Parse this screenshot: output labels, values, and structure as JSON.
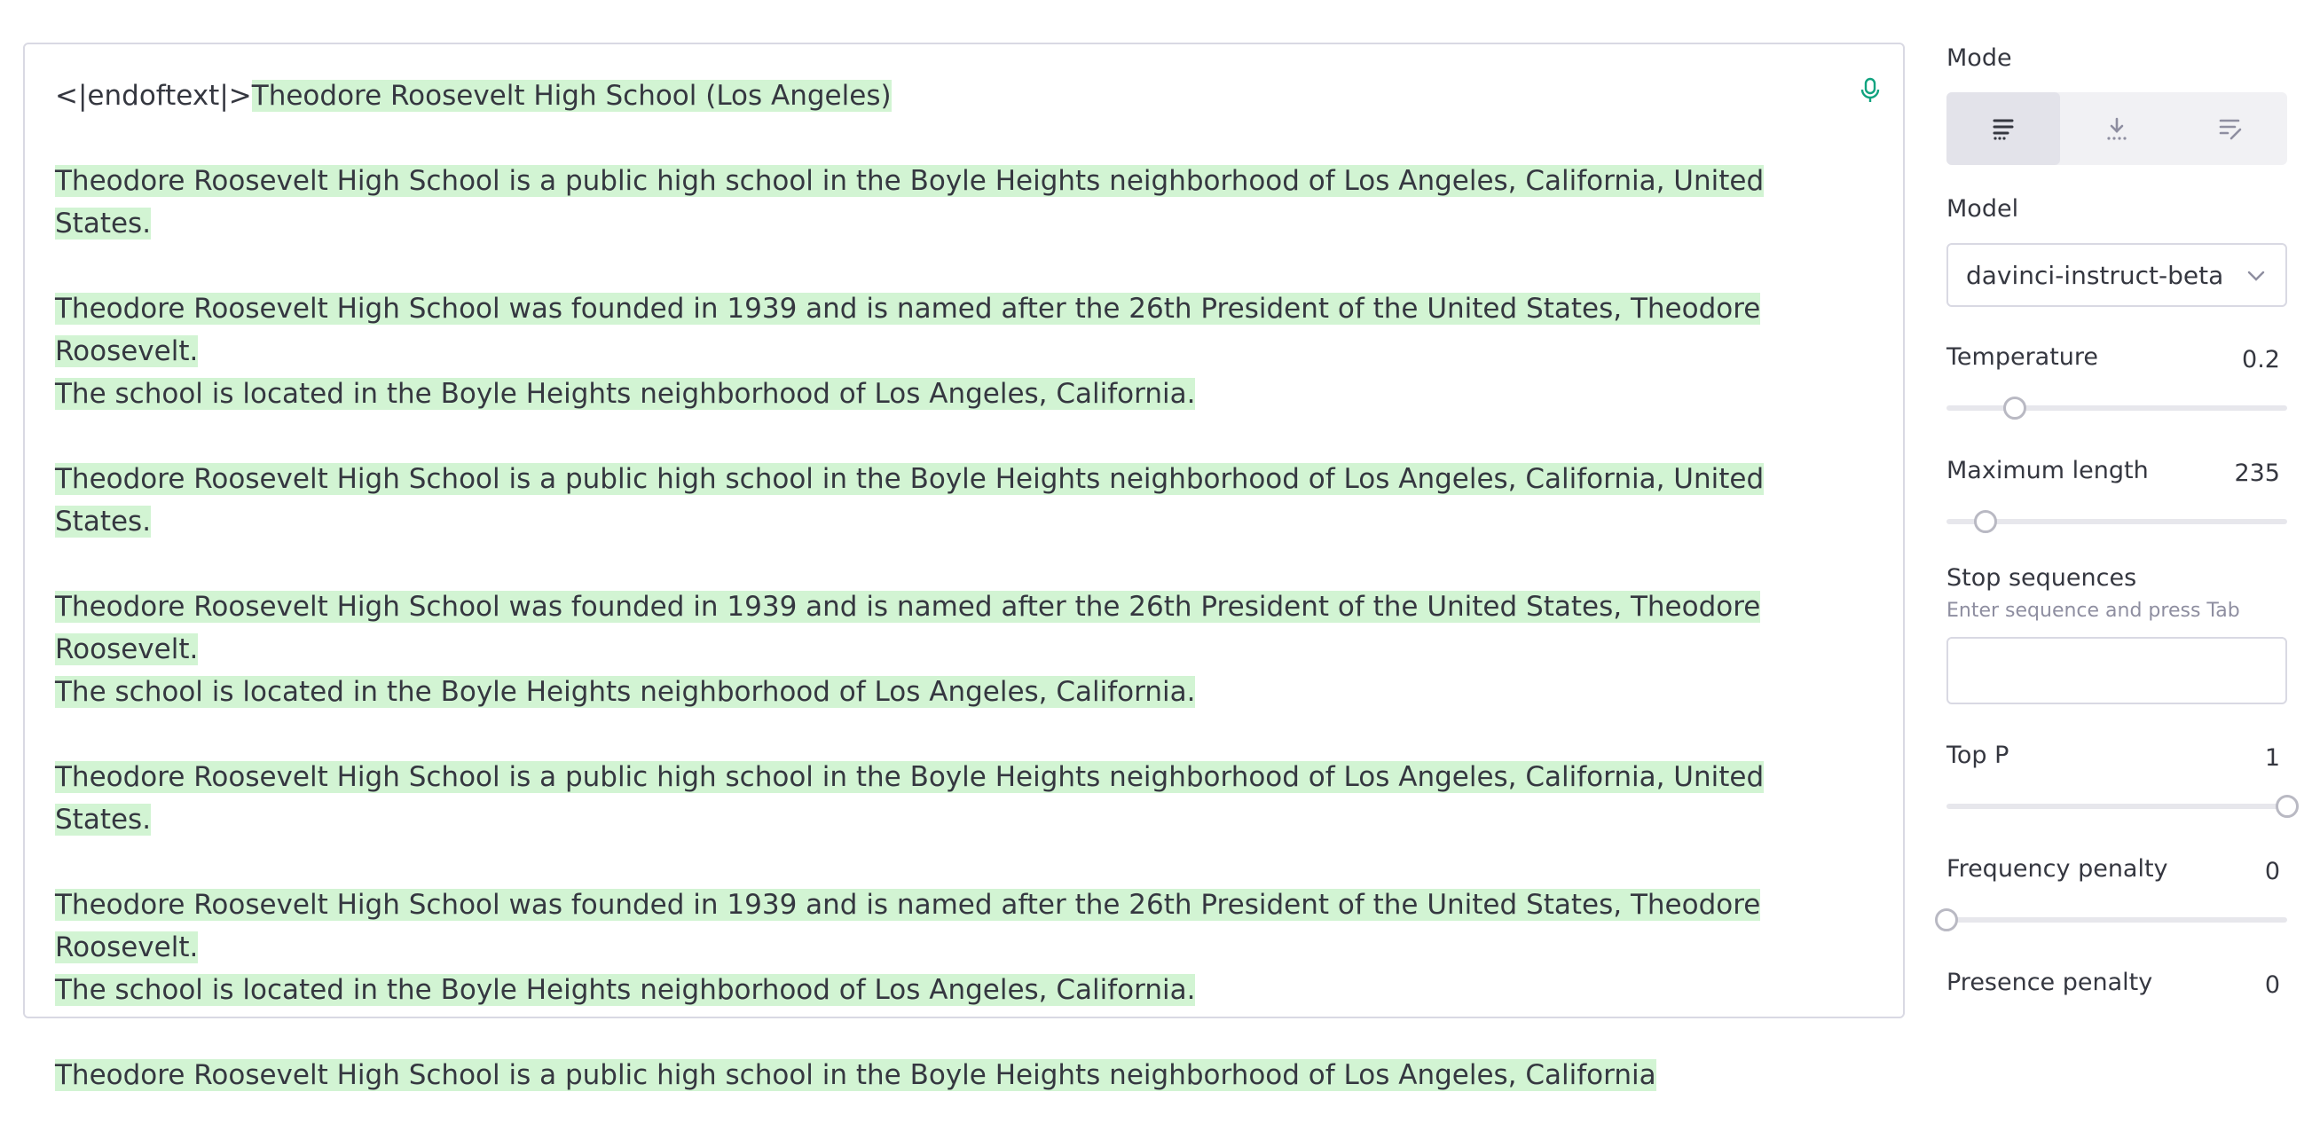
{
  "editor": {
    "prefix": "<|endoftext|>",
    "title": "Theodore Roosevelt High School (Los Angeles)",
    "paragraphs": [
      [
        "Theodore Roosevelt High School is a public high school in the Boyle Heights neighborhood of Los Angeles, California, United States."
      ],
      [
        "Theodore Roosevelt High School was founded in 1939 and is named after the 26th President of the United States, Theodore Roosevelt. ",
        "The school is located in the Boyle Heights neighborhood of Los Angeles, California."
      ],
      [
        "Theodore Roosevelt High School is a public high school in the Boyle Heights neighborhood of Los Angeles, California, United States."
      ],
      [
        "Theodore Roosevelt High School was founded in 1939 and is named after the 26th President of the United States, Theodore Roosevelt. ",
        "The school is located in the Boyle Heights neighborhood of Los Angeles, California."
      ],
      [
        "Theodore Roosevelt High School is a public high school in the Boyle Heights neighborhood of Los Angeles, California, United States."
      ],
      [
        "Theodore Roosevelt High School was founded in 1939 and is named after the 26th President of the United States, Theodore Roosevelt. ",
        "The school is located in the Boyle Heights neighborhood of Los Angeles, California."
      ],
      [
        "Theodore Roosevelt High School is a public high school in the Boyle Heights neighborhood of Los Angeles, California"
      ]
    ],
    "highlight_color": "#d2f4d3",
    "mic_icon": "microphone-icon"
  },
  "sidebar": {
    "mode_label": "Mode",
    "mode_icons": [
      "complete-mode-icon",
      "insert-mode-icon",
      "edit-mode-icon"
    ],
    "mode_active": 0,
    "model_label": "Model",
    "model_value": "davinci-instruct-beta",
    "temperature": {
      "label": "Temperature",
      "value": "0.2",
      "fraction": 0.2
    },
    "max_length": {
      "label": "Maximum length",
      "value": "235",
      "fraction": 0.115
    },
    "stop_sequences": {
      "label": "Stop sequences",
      "hint": "Enter sequence and press Tab",
      "value": ""
    },
    "top_p": {
      "label": "Top P",
      "value": "1",
      "fraction": 1.0
    },
    "frequency_penalty": {
      "label": "Frequency penalty",
      "value": "0",
      "fraction": 0.0
    },
    "presence_penalty": {
      "label": "Presence penalty",
      "value": "0"
    }
  },
  "colors": {
    "accent": "#10a37f",
    "highlight": "#d2f4d3",
    "border": "#d9d9e3"
  }
}
